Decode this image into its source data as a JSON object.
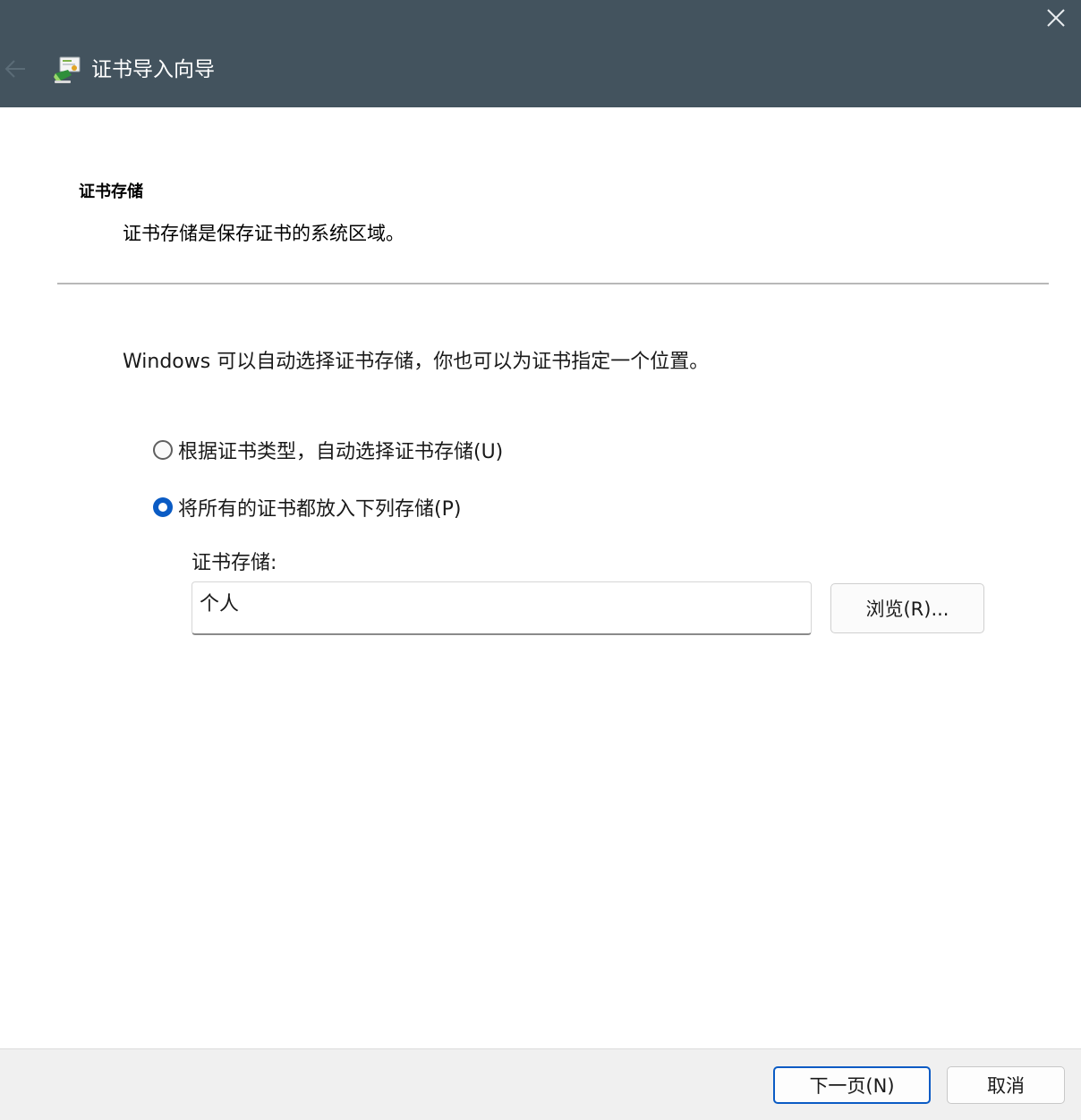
{
  "window": {
    "title": "证书导入向导",
    "accent_color": "#0a5bc4",
    "titlebar_color": "#43535e"
  },
  "icons": {
    "close": "close-icon",
    "back": "back-arrow-icon",
    "wizard": "certificate-wizard-icon"
  },
  "header": {
    "title": "证书存储",
    "description": "证书存储是保存证书的系统区域。"
  },
  "body": {
    "intro": "Windows 可以自动选择证书存储，你也可以为证书指定一个位置。",
    "options": [
      {
        "label": "根据证书类型，自动选择证书存储(U)",
        "selected": false
      },
      {
        "label": "将所有的证书都放入下列存储(P)",
        "selected": true
      }
    ],
    "store_label": "证书存储:",
    "store_value": "个人",
    "browse_label": "浏览(R)..."
  },
  "footer": {
    "next_label": "下一页(N)",
    "cancel_label": "取消"
  }
}
